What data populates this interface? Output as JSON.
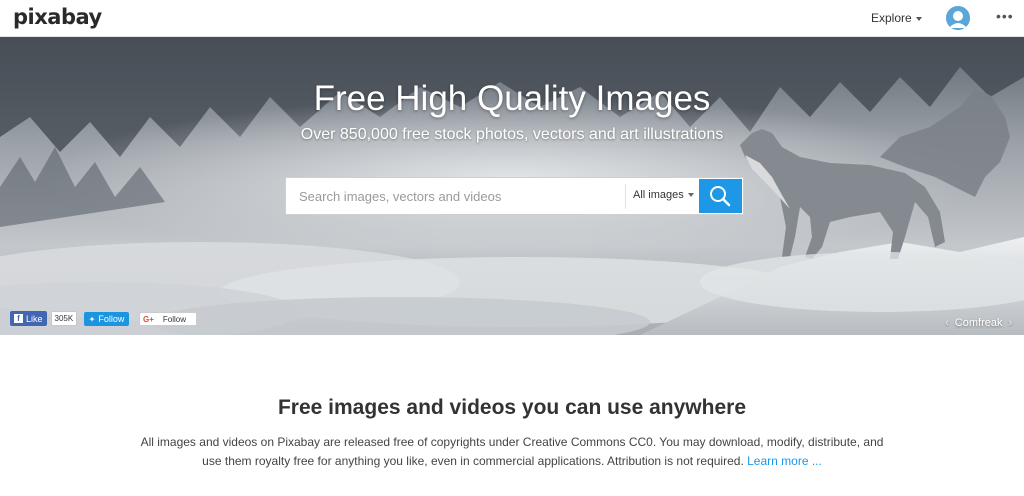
{
  "header": {
    "logo": "pixabay",
    "explore_label": "Explore",
    "more_label": "•••"
  },
  "hero": {
    "title": "Free High Quality Images",
    "subtitle": "Over 850,000 free stock photos, vectors and art illustrations",
    "search": {
      "placeholder": "Search images, vectors and videos",
      "value": "",
      "type_selected": "All images"
    },
    "social": {
      "facebook_like": "Like",
      "facebook_count": "305K",
      "twitter_follow": "Follow",
      "google_plus": "G+",
      "google_follow": "Follow"
    },
    "credit": {
      "prev": "‹",
      "name": "Comfreak",
      "next": "›"
    }
  },
  "intro": {
    "title": "Free images and videos you can use anywhere",
    "body": "All images and videos on Pixabay are released free of copyrights under Creative Commons CC0. You may download, modify, distribute, and use them royalty free for anything you like, even in commercial applications. Attribution is not required.",
    "learn_more": "Learn more ..."
  },
  "colors": {
    "accent": "#1e97e6",
    "facebook": "#4267b2",
    "twitter": "#1b95e0"
  }
}
